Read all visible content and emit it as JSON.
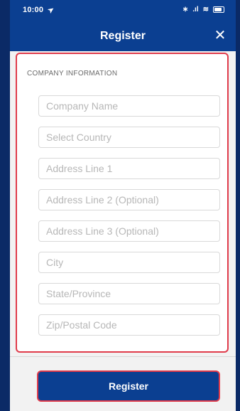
{
  "status_bar": {
    "time": "10:00",
    "location_symbol": "➤",
    "bluetooth_symbol": "∗",
    "signal_text": ".ıl",
    "wifi_symbol": "≋"
  },
  "nav": {
    "title": "Register",
    "close_symbol": "✕"
  },
  "form": {
    "section_title": "COMPANY INFORMATION",
    "fields": [
      {
        "placeholder": "Company Name",
        "value": ""
      },
      {
        "placeholder": "Select Country",
        "value": ""
      },
      {
        "placeholder": "Address Line 1",
        "value": ""
      },
      {
        "placeholder": "Address Line 2 (Optional)",
        "value": ""
      },
      {
        "placeholder": "Address Line 3 (Optional)",
        "value": ""
      },
      {
        "placeholder": "City",
        "value": ""
      },
      {
        "placeholder": "State/Province",
        "value": ""
      },
      {
        "placeholder": "Zip/Postal Code",
        "value": ""
      }
    ]
  },
  "actions": {
    "register_label": "Register"
  },
  "colors": {
    "primary": "#0b3f91",
    "highlight_border": "#e03b4b",
    "page_bg": "#f2f2f2"
  }
}
